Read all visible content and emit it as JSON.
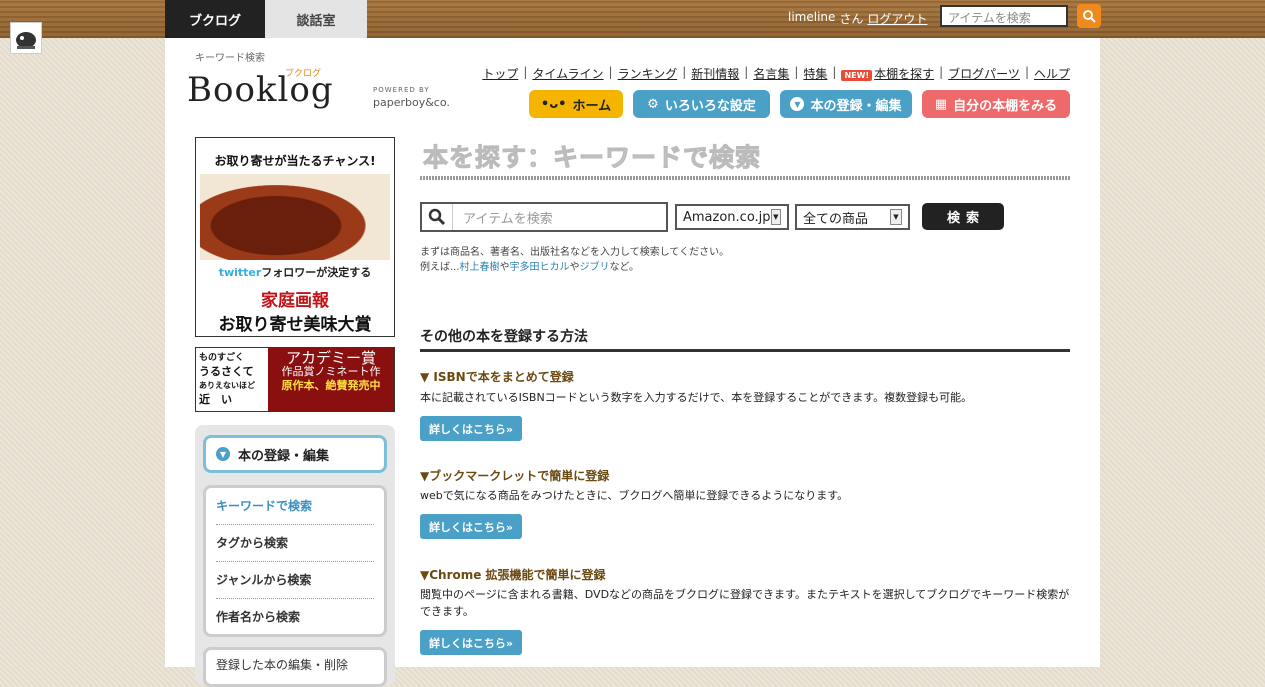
{
  "topbar": {
    "tabs": [
      {
        "label": "ブクログ"
      },
      {
        "label": "談話室"
      }
    ],
    "user": {
      "name": "limeline",
      "honorific": "さん",
      "logout": "ログアウト"
    },
    "search_placeholder": "アイテムを検索"
  },
  "header": {
    "keyword_label": "キーワード検索",
    "logo_text": "Booklog",
    "logo_ruby": "ブクログ",
    "powered_by": "POWERED BY",
    "powered_name": "paperboy&co.",
    "nav": [
      {
        "label": "トップ"
      },
      {
        "label": "タイムライン"
      },
      {
        "label": "ランキング"
      },
      {
        "label": "新刊情報"
      },
      {
        "label": "名言集"
      },
      {
        "label": "特集"
      },
      {
        "label": "本棚を探す",
        "badge": "NEW!"
      },
      {
        "label": "ブログパーツ"
      },
      {
        "label": "ヘルプ"
      }
    ],
    "pills": [
      {
        "label": "ホーム"
      },
      {
        "label": "いろいろな設定"
      },
      {
        "label": "本の登録・編集"
      },
      {
        "label": "自分の本棚をみる"
      }
    ]
  },
  "ads": {
    "ad1": {
      "headline": "お取り寄せが当たるチャンス!",
      "twitter_brand": "twitter",
      "twitter_line": "フォロワーが決定する",
      "title1": "家庭画報",
      "title2": "お取り寄せ美味大賞"
    },
    "ad2": {
      "left_l1": "ものすごく",
      "left_l2": "うるさくて",
      "left_l3": "ありえないほど",
      "left_l4": "近　い",
      "right_l1": "アカデミー賞",
      "right_l2": "作品賞ノミネート作",
      "right_l3": "原作本、絶賛発売中"
    }
  },
  "sidebar": {
    "heading": "本の登録・編集",
    "items": [
      {
        "label": "キーワードで検索"
      },
      {
        "label": "タグから検索"
      },
      {
        "label": "ジャンルから検索"
      },
      {
        "label": "作者名から検索"
      }
    ],
    "next_group_label": "登録した本の編集・削除"
  },
  "main": {
    "title": "本を探す：キーワードで検索",
    "search_placeholder": "アイテムを検索",
    "store_select": "Amazon.co.jp",
    "category_select": "全ての商品",
    "search_button": "検索",
    "hint1": "まずは商品名、著者名、出版社名などを入力して検索してください。",
    "hint2_prefix": "例えば...",
    "examples": [
      "村上春樹",
      "宇多田ヒカル",
      "ジブリ"
    ],
    "hint2_sep1": "や",
    "hint2_sep2": "や",
    "hint2_suffix": "など。",
    "section_title": "その他の本を登録する方法",
    "methods": [
      {
        "title": "▼ ISBNで本をまとめて登録",
        "desc": "本に記載されているISBNコードという数字を入力するだけで、本を登録することができます。複数登録も可能。",
        "button": "詳しくはこちら»"
      },
      {
        "title": "▼ブックマークレットで簡単に登録",
        "desc": "webで気になる商品をみつけたときに、ブクログへ簡単に登録できるようになります。",
        "button": "詳しくはこちら»"
      },
      {
        "title": "▼Chrome 拡張機能で簡単に登録",
        "desc": "閲覧中のページに含まれる書籍、DVDなどの商品をブクログに登録できます。またテキストを選択してブクログでキーワード検索ができます。",
        "button": "詳しくはこちら»"
      }
    ]
  },
  "colors": {
    "accent_blue": "#4aa0c6",
    "home_yellow": "#f5b400",
    "shelf_red": "#ee6a6a",
    "search_orange": "#f08a1c"
  }
}
